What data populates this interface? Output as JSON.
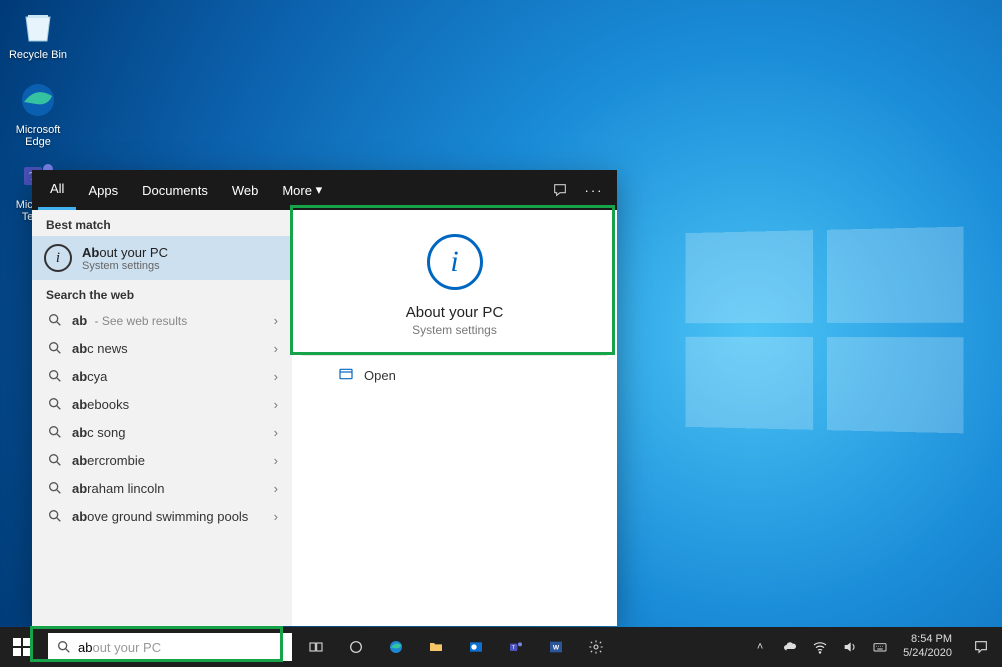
{
  "desktop": {
    "icons": [
      {
        "label": "Recycle Bin"
      },
      {
        "label": "Microsoft Edge"
      },
      {
        "label": "Microsoft Teams"
      }
    ]
  },
  "search": {
    "tabs": {
      "all": "All",
      "apps": "Apps",
      "documents": "Documents",
      "web": "Web",
      "more": "More"
    },
    "best_match_label": "Best match",
    "best_match": {
      "title_prefix": "Ab",
      "title_rest": "out your PC",
      "subtitle": "System settings"
    },
    "web_label": "Search the web",
    "web_items": [
      {
        "q": "ab",
        "rest": "",
        "hint": " - See web results"
      },
      {
        "q": "ab",
        "rest": "c news",
        "hint": ""
      },
      {
        "q": "ab",
        "rest": "cya",
        "hint": ""
      },
      {
        "q": "ab",
        "rest": "ebooks",
        "hint": ""
      },
      {
        "q": "ab",
        "rest": "c song",
        "hint": ""
      },
      {
        "q": "ab",
        "rest": "ercrombie",
        "hint": ""
      },
      {
        "q": "ab",
        "rest": "raham lincoln",
        "hint": ""
      },
      {
        "q": "ab",
        "rest": "ove ground swimming pools",
        "hint": ""
      }
    ],
    "detail": {
      "title": "About your PC",
      "subtitle": "System settings",
      "open": "Open"
    }
  },
  "taskbar": {
    "search_typed": "ab",
    "search_ghost": "out your PC",
    "time": "8:54 PM",
    "date": "5/24/2020"
  }
}
